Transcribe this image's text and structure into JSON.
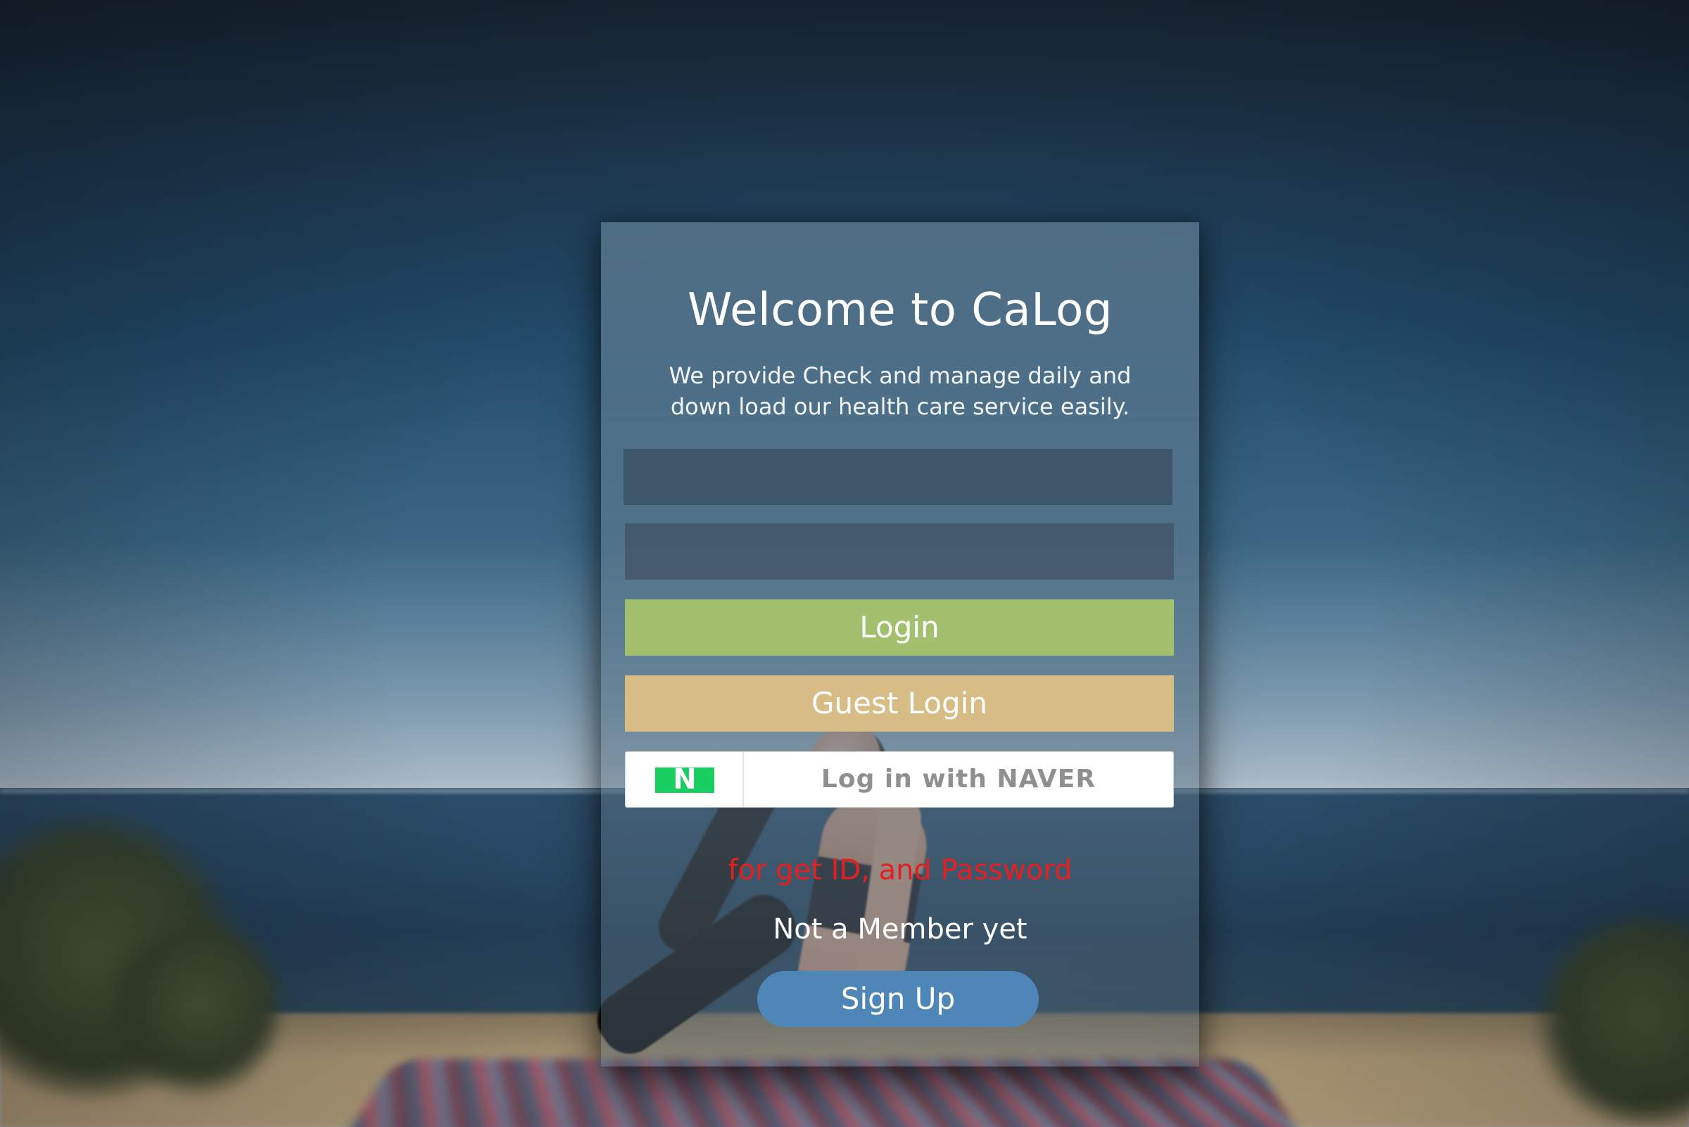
{
  "app": {
    "title": "Welcome to CaLog",
    "tagline_line1": "We provide Check and manage daily and",
    "tagline_line2": "down load our health care service easily."
  },
  "form": {
    "id_value": "",
    "password_value": ""
  },
  "buttons": {
    "login_label": "Login",
    "guest_login_label": "Guest Login",
    "naver_logo_letter": "N",
    "naver_label": "Log in with NAVER",
    "signup_label": "Sign Up"
  },
  "links": {
    "forgot": "for get ID, and Password",
    "not_member": "Not a Member yet"
  },
  "colors": {
    "login_button": "#a2c06d",
    "guest_login_button": "#d8bc86",
    "naver_green": "#19ce60",
    "forgot_link": "#e51f1f",
    "signup_button": "#4f86b8"
  },
  "icons": {
    "naver_logo": "naver-logo-icon"
  }
}
